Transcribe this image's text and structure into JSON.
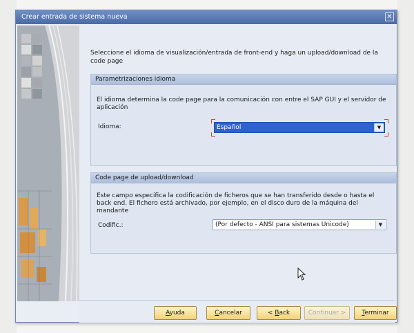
{
  "dialog": {
    "title": "Crear entrada de sistema nueva",
    "close_icon": "close-icon"
  },
  "intro": {
    "text": "Seleccione el idioma de visualización/entrada de front-end y haga un upload/download de la code page"
  },
  "language_group": {
    "header": "Parametrizaciones idioma",
    "description": "El idioma determina la code page para la comunicación con entre el SAP GUI y el servidor de aplicación",
    "label": "Idioma:",
    "selected": "Español"
  },
  "codepage_group": {
    "header": "Code page de upload/download",
    "description": "Este campo especifica la codificación de ficheros que se han transferido desde o hasta el back end. El fichero está archivado, por ejemplo, en el disco duro de la máquina del mandante",
    "label": "Codific.:",
    "selected": "(Por defecto - ANSI para sistemas Unicode)"
  },
  "buttons": {
    "help": {
      "mnemonic": "A",
      "rest": "yuda"
    },
    "cancel": {
      "mnemonic": "C",
      "rest": "ancelar"
    },
    "back": {
      "prefix": "< ",
      "mnemonic": "B",
      "rest": "ack"
    },
    "continue": {
      "label": "Continuar >",
      "enabled": false
    },
    "finish": {
      "mnemonic": "T",
      "rest": "erminar"
    }
  },
  "colors": {
    "titlebar": "#4a6aa5",
    "selection": "#2c63cf",
    "button": "#f2d27a"
  }
}
